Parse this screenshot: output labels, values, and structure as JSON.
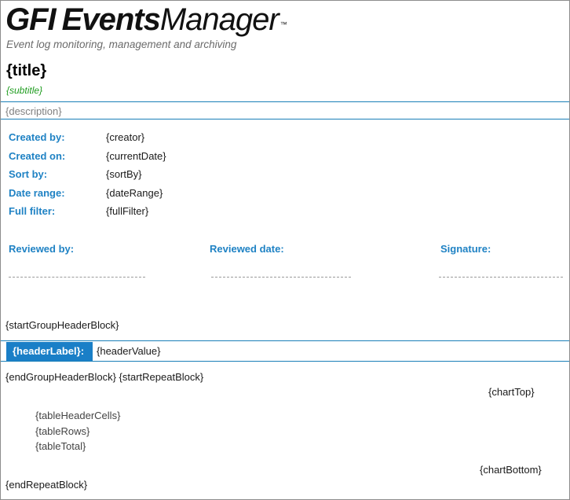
{
  "logo": {
    "gfi": "GFI",
    "events": "Events",
    "manager": "Manager",
    "tm": "™",
    "tagline": "Event log monitoring, management and archiving"
  },
  "report": {
    "title": "{title}",
    "subtitle": "{subtitle}",
    "description": "{description}"
  },
  "fields": [
    {
      "label": "Created by:",
      "value": "{creator}"
    },
    {
      "label": "Created on:",
      "value": "{currentDate}"
    },
    {
      "label": "Sort by:",
      "value": "{sortBy}"
    },
    {
      "label": "Date range:",
      "value": "{dateRange}"
    },
    {
      "label": "Full filter:",
      "value": "{fullFilter}"
    }
  ],
  "review": {
    "reviewed_by": "Reviewed by:",
    "reviewed_date": "Reviewed date:",
    "signature": "Signature:"
  },
  "blocks": {
    "start_group_header": "{startGroupHeaderBlock}",
    "header_label": "{headerLabel}:",
    "header_value": "{headerValue}",
    "end_group_start_repeat": "{endGroupHeaderBlock} {startRepeatBlock}",
    "chart_top": "{chartTop}",
    "table_header_cells": "{tableHeaderCells}",
    "table_rows": "{tableRows}",
    "table_total": "{tableTotal}",
    "chart_bottom": "{chartBottom}",
    "end_repeat": "{endRepeatBlock}"
  },
  "colors": {
    "accent_blue": "#1f82c4",
    "header_band": "#1a7fc7",
    "subtitle_green": "#1f9c1f"
  }
}
